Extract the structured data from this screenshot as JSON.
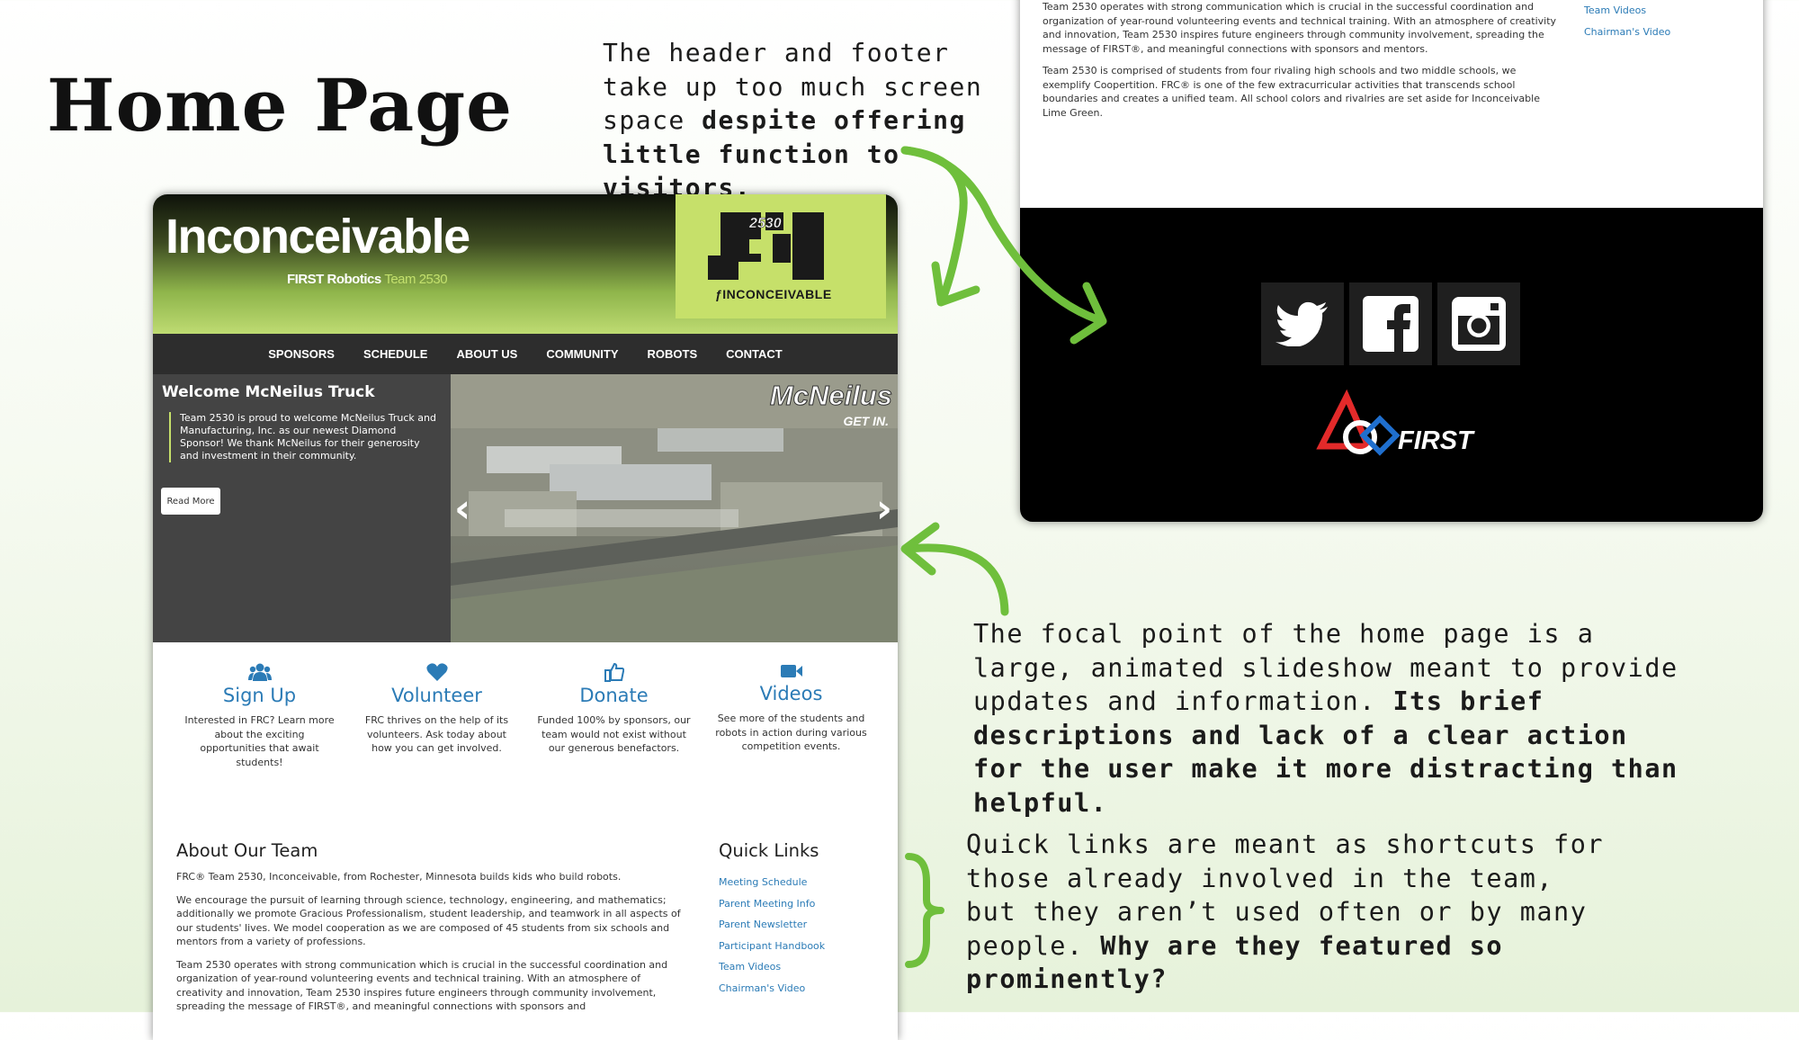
{
  "slide": {
    "title": "Home Page",
    "note_header": {
      "plain": "The header and footer take up too much screen space ",
      "bold": "despite offering little function to visitors."
    },
    "note_slideshow": {
      "plain": "The focal point of the home page is a large, animated slideshow meant to provide updates and information. ",
      "bold": "Its brief descriptions and lack of a clear action for the user make it more distracting than helpful."
    },
    "note_quicklinks": {
      "plain": "Quick links are meant as shortcuts for those already involved in the team, but they aren’t used often or by many people. ",
      "bold": "Why are they featured so prominently?"
    },
    "accent_color": "#6fbf3c"
  },
  "site": {
    "brand": {
      "name": "Inconceivable",
      "tagline_prefix": "FIRST Robotics ",
      "tagline_team": "Team 2530",
      "logo_number": "2530",
      "logo_word": "INCONCEIVABLE",
      "logo_bg": "#c6e06a"
    },
    "nav": [
      "SPONSORS",
      "SCHEDULE",
      "ABOUT US",
      "COMMUNITY",
      "ROBOTS",
      "CONTACT"
    ],
    "hero": {
      "title": "Welcome McNeilus Truck",
      "text": "Team 2530 is proud to welcome McNeilus Truck and Manufacturing, Inc. as our newest Diamond Sponsor! We thank McNeilus for their generosity and investment in their community.",
      "button": "Read More",
      "image_logo": "McNeilus",
      "image_sub": "GET IN.",
      "prev_icon": "chevron-left-icon",
      "next_icon": "chevron-right-icon"
    },
    "features": [
      {
        "icon": "users-icon",
        "title": "Sign Up",
        "desc": "Interested in FRC? Learn more about the exciting opportunities that await students!"
      },
      {
        "icon": "heart-icon",
        "title": "Volunteer",
        "desc": "FRC thrives on the help of its volunteers. Ask today about how you can get involved."
      },
      {
        "icon": "thumbs-up-icon",
        "title": "Donate",
        "desc": "Funded 100% by sponsors, our team would not exist without our generous benefactors."
      },
      {
        "icon": "video-camera-icon",
        "title": "Videos",
        "desc": "See more of the students and robots in action during various competition events."
      }
    ],
    "about": {
      "title": "About Our Team",
      "p1": "FRC® Team 2530, Inconceivable, from Rochester, Minnesota builds kids who build robots.",
      "p2": "We encourage the pursuit of learning through science, technology, engineering, and mathematics; additionally we promote Gracious Professionalism, student leadership, and teamwork in all aspects of our students' lives. We model cooperation as we are composed of 45 students from six schools and mentors from a variety of professions.",
      "p3": "Team 2530 operates with strong communication which is crucial in the successful coordination and organization of year-round volunteering events and technical training. With an atmosphere of creativity and innovation, Team 2530 inspires future engineers through community involvement, spreading the message of FIRST®, and meaningful connections with sponsors and"
    },
    "quick_links": {
      "title": "Quick Links",
      "items": [
        "Meeting Schedule",
        "Parent Meeting Info",
        "Parent Newsletter",
        "Participant Handbook",
        "Team Videos",
        "Chairman's Video"
      ]
    }
  },
  "site2": {
    "p1": "Team 2530 operates with strong communication which is crucial in the successful coordination and organization of year-round volunteering events and technical training. With an atmosphere of creativity and innovation, Team 2530 inspires future engineers through community involvement, spreading the message of FIRST®, and meaningful connections with sponsors and mentors.",
    "p2": "Team 2530 is comprised of students from four rivaling high schools and two middle schools, we exemplify Coopertition. FRC® is one of the few extracurricular activities that transcends school boundaries and creates a unified team. All school colors and rivalries are set aside for Inconceivable Lime Green.",
    "links": [
      "Team Videos",
      "Chairman's Video"
    ],
    "social_icons": [
      "twitter-icon",
      "facebook-icon",
      "instagram-icon"
    ],
    "first_logo_text": "FIRST"
  }
}
